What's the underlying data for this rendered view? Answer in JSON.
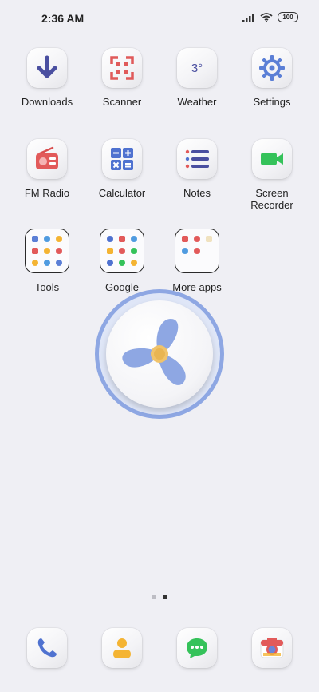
{
  "status_bar": {
    "time": "2:36 AM",
    "battery": "100"
  },
  "apps_row1": [
    {
      "label": "Downloads",
      "icon": "download-arrow-icon"
    },
    {
      "label": "Scanner",
      "icon": "scanner-icon"
    },
    {
      "label": "Weather",
      "icon": "weather-icon",
      "value": "3°"
    },
    {
      "label": "Settings",
      "icon": "gear-icon"
    }
  ],
  "apps_row2": [
    {
      "label": "FM Radio",
      "icon": "radio-icon"
    },
    {
      "label": "Calculator",
      "icon": "calculator-icon"
    },
    {
      "label": "Notes",
      "icon": "notes-icon"
    },
    {
      "label": "Screen\nRecorder",
      "icon": "video-camera-icon"
    }
  ],
  "folders": [
    {
      "label": "Tools"
    },
    {
      "label": "Google"
    },
    {
      "label": "More apps"
    }
  ],
  "widget": {
    "name": "fan-widget"
  },
  "page_indicator": {
    "count": 2,
    "active": 2
  },
  "dock": [
    {
      "icon": "phone-icon"
    },
    {
      "icon": "contacts-icon"
    },
    {
      "icon": "messages-icon"
    },
    {
      "icon": "camera-icon"
    }
  ],
  "colors": {
    "background": "#efeff4",
    "accent_blue": "#6b86d8",
    "accent_red": "#e25a5a",
    "accent_green": "#35c25a",
    "accent_yellow": "#f4b433"
  }
}
